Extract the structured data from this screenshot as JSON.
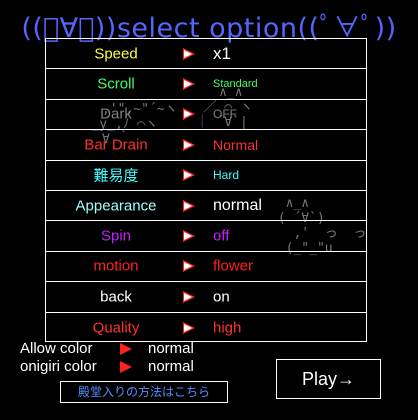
{
  "title": "((ﾟ∀ﾟ))select option((ﾟ∀ﾟ))",
  "options": [
    {
      "label": "Speed",
      "label_color": "#ffff40",
      "value": "x1",
      "value_color": "#ffffff",
      "value_size": "17px"
    },
    {
      "label": "Scroll",
      "label_color": "#40ff60",
      "value": "Standard",
      "value_color": "#40ff60",
      "value_size": "11px"
    },
    {
      "label": "Dark",
      "label_color": "#808080",
      "value": "OFF",
      "value_color": "#808080",
      "value_size": "12px"
    },
    {
      "label": "Bar Drain",
      "label_color": "#ff3030",
      "value": "Normal",
      "value_color": "#ff3030",
      "value_size": "14px"
    },
    {
      "label": "難易度",
      "label_color": "#40ffff",
      "value": "Hard",
      "value_color": "#40ffff",
      "value_size": "12px"
    },
    {
      "label": "Appearance",
      "label_color": "#a0ffff",
      "value": "normal",
      "value_color": "#ffffff",
      "value_size": "16px"
    },
    {
      "label": "Spin",
      "label_color": "#c020ff",
      "value": "off",
      "value_color": "#c020ff",
      "value_size": "15px"
    },
    {
      "label": "motion",
      "label_color": "#ff2020",
      "value": "flower",
      "value_color": "#ff2020",
      "value_size": "15px"
    },
    {
      "label": "back",
      "label_color": "#ffffff",
      "value": "on",
      "value_color": "#ffffff",
      "value_size": "15px"
    },
    {
      "label": "Quality",
      "label_color": "#ff3030",
      "value": "high",
      "value_color": "#ff3030",
      "value_size": "15px"
    }
  ],
  "allow_color": {
    "label": "Allow color",
    "value": "normal"
  },
  "onigiri_color": {
    "label": "onigiri color",
    "value": "normal"
  },
  "hall_of_fame_link": "殿堂入りの方法はこちら",
  "play_button": "Play→"
}
